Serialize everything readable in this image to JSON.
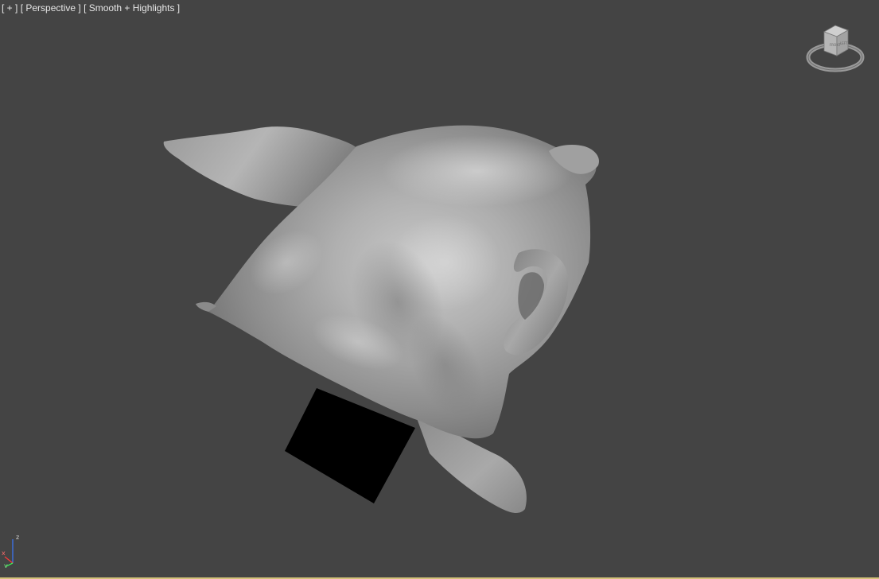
{
  "viewport": {
    "label_plus": "[ + ]",
    "label_view": "[ Perspective ]",
    "label_shading": "[ Smooth + Highlights ]",
    "background_color": "#444444",
    "active_border_color": "#d4c27a"
  },
  "viewcube": {
    "icon": "viewcube-icon",
    "face_front": "FRONT",
    "face_left": "LEFT"
  },
  "axis_tripod": {
    "icon": "axis-tripod-icon",
    "x_label": "x",
    "y_label": "y",
    "z_label": "z"
  },
  "scene": {
    "object": "cloth-drape-mesh",
    "shadow": "mesh-shadow"
  }
}
